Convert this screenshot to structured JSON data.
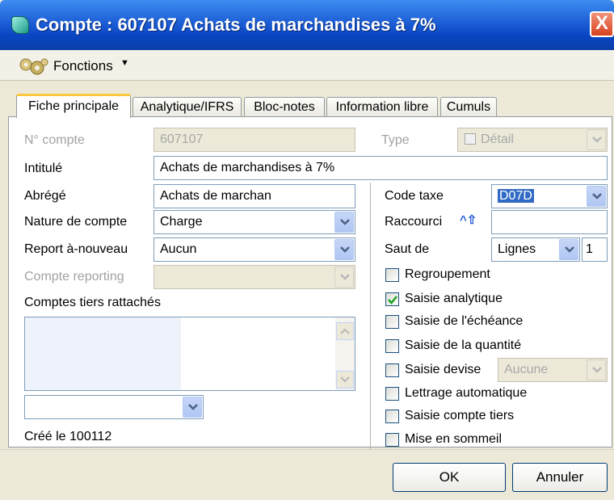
{
  "window": {
    "title": "Compte : 607107 Achats de marchandises à 7%",
    "close_label": "X"
  },
  "toolbar": {
    "functions_label": "Fonctions"
  },
  "tabs": [
    {
      "label": "Fiche principale",
      "active": true
    },
    {
      "label": "Analytique/IFRS",
      "active": false
    },
    {
      "label": "Bloc-notes",
      "active": false
    },
    {
      "label": "Information libre",
      "active": false
    },
    {
      "label": "Cumuls",
      "active": false
    }
  ],
  "form": {
    "num_compte": {
      "label": "N° compte",
      "value": "607107"
    },
    "type": {
      "label": "Type",
      "value": "Détail"
    },
    "intitule": {
      "label": "Intitulé",
      "value": "Achats de marchandises à 7%"
    },
    "abrege": {
      "label": "Abrégé",
      "value": "Achats de marchan"
    },
    "nature": {
      "label": "Nature de compte",
      "value": "Charge"
    },
    "report": {
      "label": "Report à-nouveau",
      "value": "Aucun"
    },
    "reporting": {
      "label": "Compte reporting",
      "value": ""
    },
    "tiers": {
      "label": "Comptes tiers rattachés",
      "value": ""
    },
    "created": "Créé le 100112",
    "code_taxe": {
      "label": "Code taxe",
      "value": "D07D"
    },
    "raccourci": {
      "label": "Raccourci",
      "value": ""
    },
    "saut": {
      "label": "Saut de",
      "unit": "Lignes",
      "value": "1"
    },
    "devise_value": "Aucune"
  },
  "checkboxes": [
    {
      "label": "Regroupement",
      "checked": false
    },
    {
      "label": "Saisie analytique",
      "checked": true
    },
    {
      "label": "Saisie de l'échéance",
      "checked": false
    },
    {
      "label": "Saisie de la quantité",
      "checked": false
    },
    {
      "label": "Saisie devise",
      "checked": false
    },
    {
      "label": "Lettrage automatique",
      "checked": false
    },
    {
      "label": "Saisie compte tiers",
      "checked": false
    },
    {
      "label": "Mise en sommeil",
      "checked": false
    }
  ],
  "buttons": {
    "ok": "OK",
    "cancel": "Annuler"
  },
  "colors": {
    "title_bar": "#0a46c4",
    "tab_highlight": "#ffc83c",
    "selection": "#316ac5"
  }
}
